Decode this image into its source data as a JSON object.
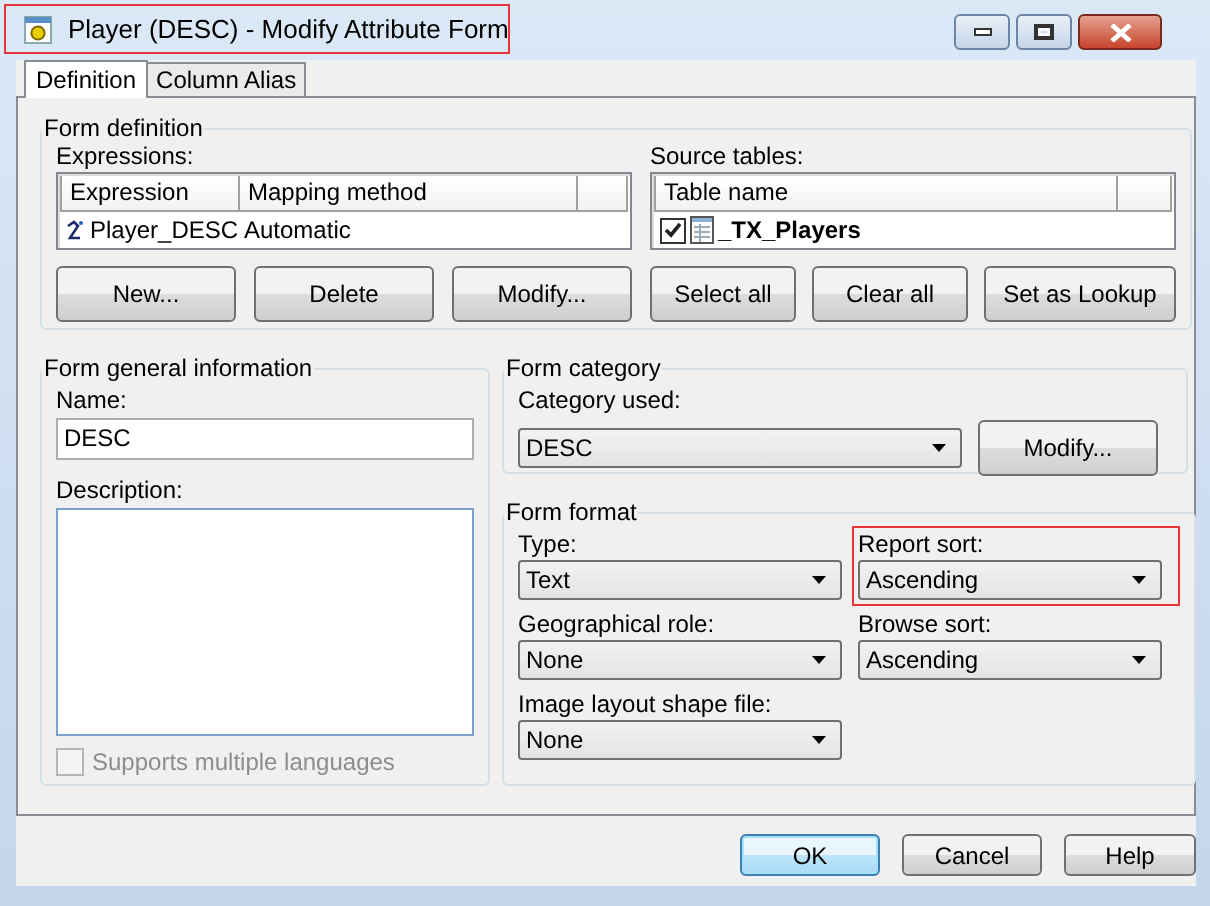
{
  "window": {
    "title": "Player (DESC) - Modify Attribute Form",
    "highlighted": true
  },
  "tabs": [
    {
      "label": "Definition",
      "selected": true
    },
    {
      "label": "Column Alias",
      "selected": false
    }
  ],
  "form_definition": {
    "title": "Form definition",
    "expressions": {
      "label": "Expressions:",
      "columns": [
        "Expression",
        "Mapping method"
      ],
      "rows": [
        {
          "expression": "Player_DESC",
          "mapping_method": "Automatic"
        }
      ]
    },
    "source_tables": {
      "label": "Source tables:",
      "columns": [
        "Table name"
      ],
      "rows": [
        {
          "name": "_TX_Players",
          "checked": true
        }
      ]
    },
    "expression_buttons": [
      "New...",
      "Delete",
      "Modify..."
    ],
    "table_buttons": [
      "Select all",
      "Clear all",
      "Set as Lookup"
    ]
  },
  "general": {
    "title": "Form general information",
    "name": {
      "label": "Name:",
      "value": "DESC"
    },
    "description": {
      "label": "Description:"
    },
    "supports_multiple_languages": {
      "label": "Supports multiple languages",
      "checked": false,
      "disabled": true
    }
  },
  "category": {
    "title": "Form category",
    "label": "Category used:",
    "value": "DESC",
    "button": "Modify..."
  },
  "format": {
    "title": "Form format",
    "fields": [
      {
        "label": "Type:",
        "value": "Text",
        "highlighted": false
      },
      {
        "label": "Report sort:",
        "value": "Ascending",
        "highlighted": true
      },
      {
        "label": "Geographical role:",
        "value": "None",
        "highlighted": false
      },
      {
        "label": "Browse sort:",
        "value": "Ascending",
        "highlighted": false
      },
      {
        "label": "Image layout shape file:",
        "value": "None",
        "highlighted": false
      }
    ]
  },
  "buttons": [
    {
      "label": "OK",
      "default": true
    },
    {
      "label": "Cancel",
      "default": false
    },
    {
      "label": "Help",
      "default": false
    }
  ]
}
